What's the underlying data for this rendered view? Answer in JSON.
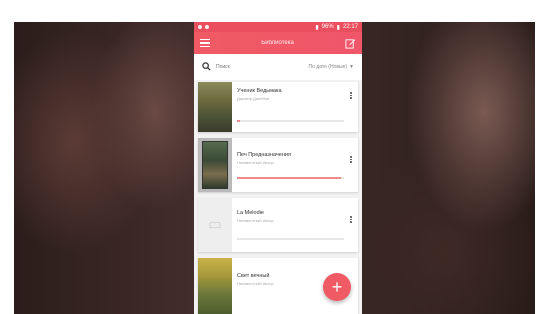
{
  "app": {
    "title": "Библиотека"
  },
  "status_bar": {
    "battery": "96%",
    "time": "22:17"
  },
  "search": {
    "placeholder": "Поиск",
    "sort_label": "По дате (Новые)"
  },
  "books": [
    {
      "title": "Ученик Ведьмака",
      "author": "Джозеф Дилейни",
      "progress": 0.03
    },
    {
      "title": "Печ Предназначения",
      "author": "Неизвестный Автор",
      "progress": 0.97
    },
    {
      "title": "La Melodie",
      "author": "Неизвестный Автор",
      "progress": 0.0
    },
    {
      "title": "Свет вечный",
      "author": "Неизвестный Автор",
      "progress": 0.0
    }
  ],
  "colors": {
    "accent": "#ef5a64",
    "progress": "#f08a8a"
  },
  "icons": [
    "menu-icon",
    "edit-icon",
    "search-icon",
    "more-vert-icon",
    "add-icon",
    "book-placeholder-icon"
  ]
}
